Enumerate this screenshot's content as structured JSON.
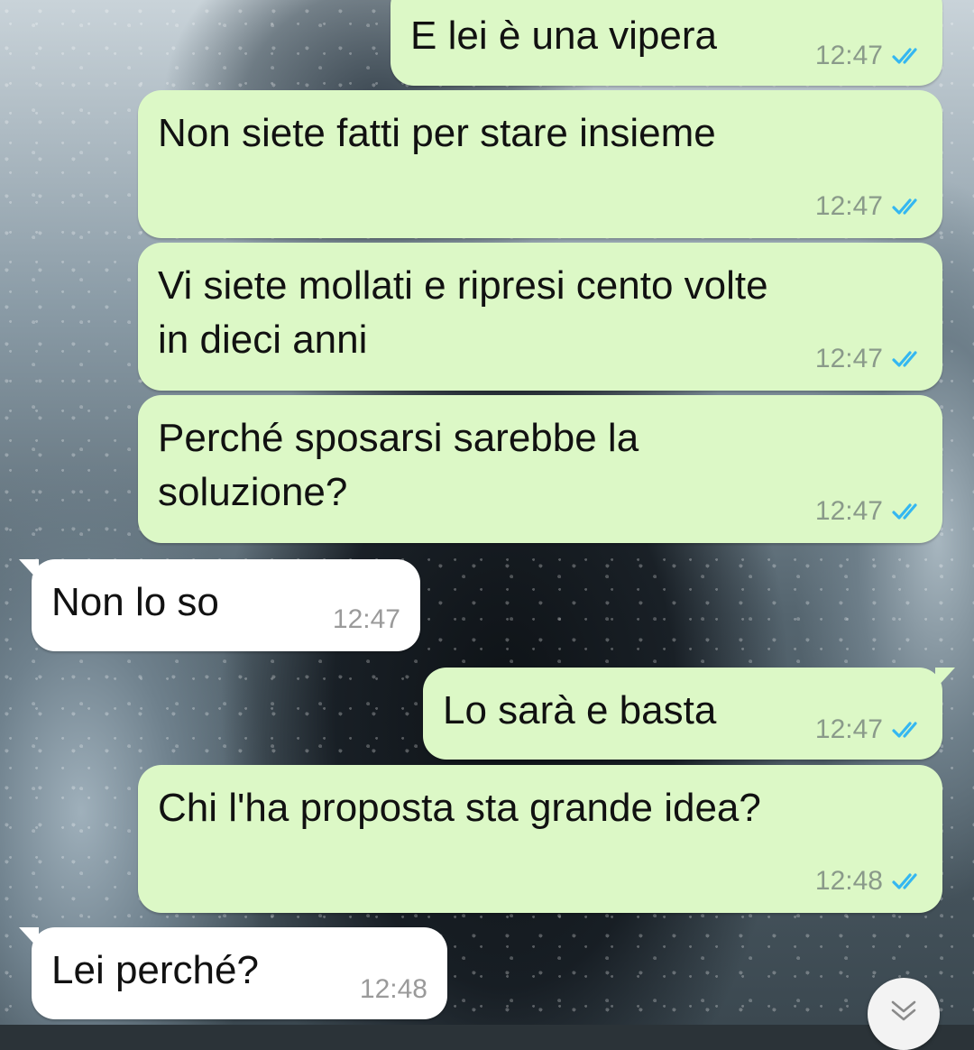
{
  "colors": {
    "outgoing_bubble": "#dcf8c6",
    "incoming_bubble": "#ffffff",
    "read_ticks": "#34b7f1",
    "timestamp": "#8a9a8a"
  },
  "messages": [
    {
      "direction": "outgoing",
      "text": "E lei è una vipera",
      "time": "12:47",
      "status": "read",
      "status_icon": "double-check-icon"
    },
    {
      "direction": "outgoing",
      "text": "Non siete fatti per stare insieme",
      "time": "12:47",
      "status": "read",
      "status_icon": "double-check-icon"
    },
    {
      "direction": "outgoing",
      "text": "Vi siete mollati e ripresi cento volte\nin dieci anni",
      "time": "12:47",
      "status": "read",
      "status_icon": "double-check-icon"
    },
    {
      "direction": "outgoing",
      "text": "Perché sposarsi sarebbe la\nsoluzione?",
      "time": "12:47",
      "status": "read",
      "status_icon": "double-check-icon"
    },
    {
      "direction": "incoming",
      "text": "Non lo so",
      "time": "12:47"
    },
    {
      "direction": "outgoing",
      "text": "Lo sarà e basta",
      "time": "12:47",
      "status": "read",
      "status_icon": "double-check-icon"
    },
    {
      "direction": "outgoing",
      "text": "Chi l'ha proposta sta grande idea?",
      "time": "12:48",
      "status": "read",
      "status_icon": "double-check-icon"
    },
    {
      "direction": "incoming",
      "text": "Lei perché?",
      "time": "12:48"
    }
  ],
  "scroll_button": {
    "icon": "double-chevron-down-icon"
  }
}
